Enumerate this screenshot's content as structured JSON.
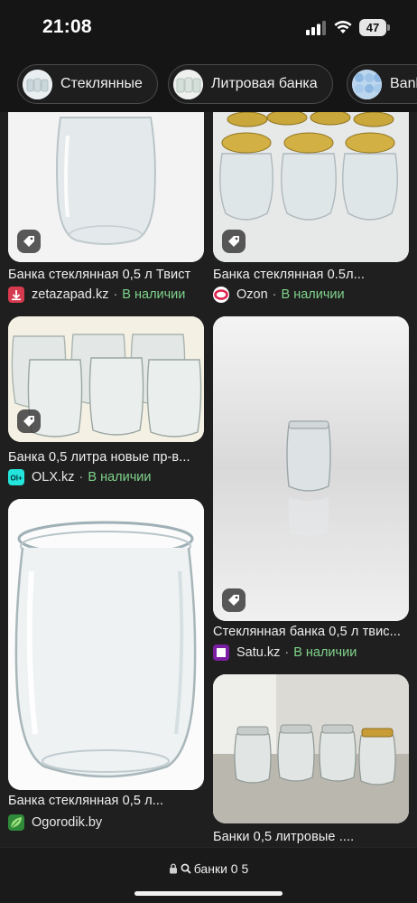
{
  "status_bar": {
    "time": "21:08",
    "battery": "47"
  },
  "chips": [
    {
      "label": "Стеклянные"
    },
    {
      "label": "Литровая банка"
    },
    {
      "label": "Bank"
    }
  ],
  "results": [
    {
      "title": "Банка стеклянная 0,5 л Твист",
      "source": "zetazapad.kz",
      "availability": "В наличии"
    },
    {
      "title": "Банка стеклянная 0.5л...",
      "source": "Ozon",
      "availability": "В наличии"
    },
    {
      "title": "Банка 0,5 литра новые пр-в...",
      "source": "OLX.kz",
      "availability": "В наличии"
    },
    {
      "title": "Стеклянная банка 0,5 л твис...",
      "source": "Satu.kz",
      "availability": "В наличии"
    },
    {
      "title": "Банка стеклянная 0,5 л...",
      "source": "Ogorodik.by",
      "availability": ""
    },
    {
      "title": "Банки 0,5 литровые ....",
      "source": "",
      "availability": ""
    }
  ],
  "bottom_bar": {
    "query": "банки 0 5"
  },
  "colors": {
    "availability": "#7fd38b",
    "background": "#1f1f1f"
  },
  "icons": [
    "signal-icon",
    "wifi-icon",
    "battery-icon",
    "tag-icon",
    "lock-icon",
    "search-icon"
  ]
}
